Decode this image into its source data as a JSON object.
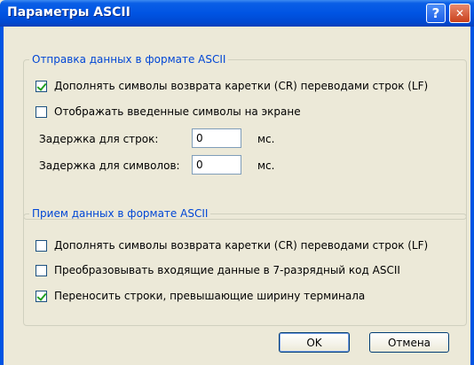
{
  "window": {
    "title": "Параметры ASCII"
  },
  "titlebar": {
    "help_glyph": "?",
    "close_glyph": "✕"
  },
  "send_group": {
    "legend": "Отправка данных в формате ASCII",
    "append_lf": {
      "label": "Дополнять символы возврата каретки (CR) переводами строк (LF)",
      "checked": true
    },
    "echo_local": {
      "label": "Отображать введенные символы на экране",
      "checked": false
    },
    "line_delay": {
      "label": "Задержка для строк:",
      "value": "0",
      "unit": "мс."
    },
    "char_delay": {
      "label": "Задержка для символов:",
      "value": "0",
      "unit": "мс."
    }
  },
  "receive_group": {
    "legend": "Прием данных в формате ASCII",
    "append_lf": {
      "label": "Дополнять символы возврата каретки (CR) переводами строк (LF)",
      "checked": false
    },
    "force_7bit": {
      "label": "Преобразовывать входящие данные в 7-разрядный код ASCII",
      "checked": false
    },
    "wrap_lines": {
      "label": "Переносить строки, превышающие ширину терминала",
      "checked": true
    }
  },
  "buttons": {
    "ok": "OK",
    "cancel": "Отмена"
  }
}
